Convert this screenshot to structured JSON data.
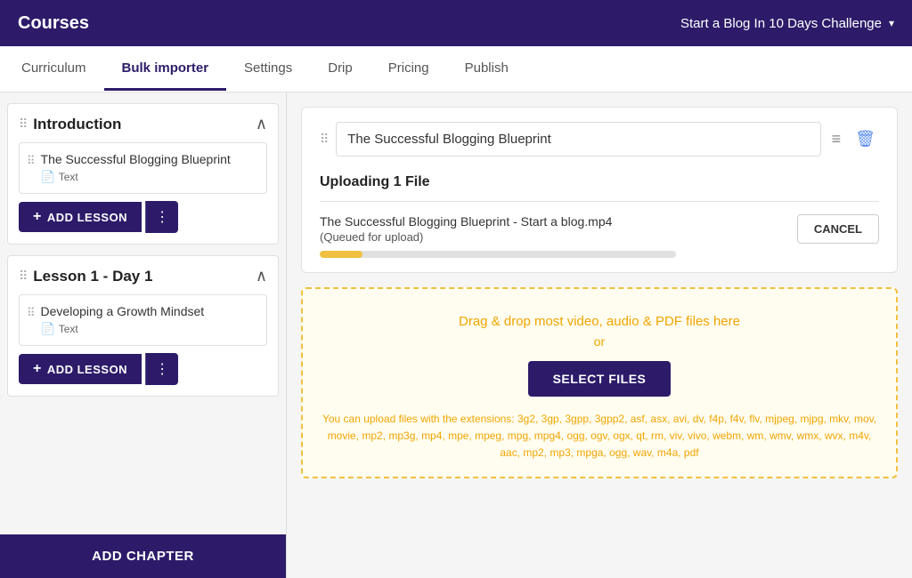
{
  "header": {
    "app_title": "Courses",
    "course_name": "Start a Blog In 10 Days Challenge",
    "chevron": "▾"
  },
  "nav": {
    "tabs": [
      {
        "label": "Curriculum",
        "active": false
      },
      {
        "label": "Bulk importer",
        "active": true
      },
      {
        "label": "Settings",
        "active": false
      },
      {
        "label": "Drip",
        "active": false
      },
      {
        "label": "Pricing",
        "active": false
      },
      {
        "label": "Publish",
        "active": false
      }
    ]
  },
  "sidebar": {
    "chapters": [
      {
        "title": "Introduction",
        "lessons": [
          {
            "name": "The Successful Blogging Blueprint",
            "type": "Text"
          }
        ],
        "add_lesson_label": "ADD LESSON"
      },
      {
        "title": "Lesson 1 - Day 1",
        "lessons": [
          {
            "name": "Developing a Growth Mindset",
            "type": "Text"
          }
        ],
        "add_lesson_label": "ADD LESSON"
      }
    ],
    "add_chapter_label": "ADD CHAPTER"
  },
  "main": {
    "lesson_title_value": "The Successful Blogging Blueprint",
    "upload_section_title": "Uploading 1 File",
    "file": {
      "name": "The Successful Blogging Blueprint - Start a blog.mp4",
      "status": "(Queued for upload)",
      "progress_percent": 12
    },
    "cancel_label": "CANCEL",
    "dropzone": {
      "text": "Drag & drop most video, audio & PDF files here",
      "or": "or",
      "button_label": "SELECT FILES",
      "extensions_text": "You can upload files with the extensions: 3g2, 3gp, 3gpp, 3gpp2, asf, asx, avi, dv, f4p, f4v, flv, mjpeg, mjpg, mkv, mov, movie, mp2, mp3g, mp4, mpe, mpeg, mpg, mpg4, ogg, ogv, ogx, qt, rm, viv, vivo, webm, wm, wmv, wmx, wvx, m4v, aac, mp2, mp3, mpga, ogg, wav, m4a, pdf"
    }
  },
  "icons": {
    "drag": "⠿",
    "chevron_up": "∧",
    "file_text": "📄",
    "doc_icon": "≡",
    "trash": "🗑"
  }
}
